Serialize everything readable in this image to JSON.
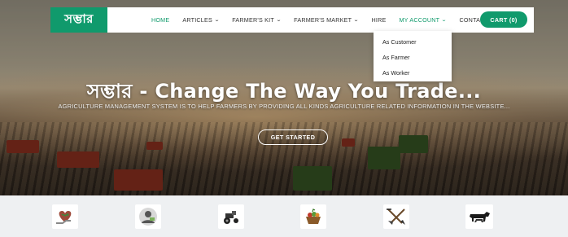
{
  "nav": {
    "logo_text": "সম্ভার",
    "items": [
      {
        "label": "HOME",
        "active": true,
        "has_caret": false
      },
      {
        "label": "ARTICLES",
        "active": false,
        "has_caret": true
      },
      {
        "label": "FARMER'S KIT",
        "active": false,
        "has_caret": true
      },
      {
        "label": "FARMER'S MARKET",
        "active": false,
        "has_caret": true
      },
      {
        "label": "HIRE",
        "active": false,
        "has_caret": false
      },
      {
        "label": "MY ACCOUNT",
        "active": false,
        "has_caret": true
      },
      {
        "label": "CONTACT",
        "active": false,
        "has_caret": false
      }
    ],
    "cart_label": "CART (0)"
  },
  "account_dropdown": {
    "items": [
      "As Customer",
      "As Farmer",
      "As Worker"
    ]
  },
  "hero": {
    "title": "সম্ভার - Change The Way You Trade...",
    "subtitle": "AGRICULTURE MANAGEMENT SYSTEM IS TO HELP FARMERS BY PROVIDING ALL KINDS AGRICULTURE RELATED INFORMATION IN THE WEBSITE...",
    "cta_label": "GET STARTED"
  },
  "categories": [
    {
      "icon": "heart-hand-icon"
    },
    {
      "icon": "farmer-avatar-icon"
    },
    {
      "icon": "tractor-icon"
    },
    {
      "icon": "vegetable-basket-icon"
    },
    {
      "icon": "shovel-rake-icon"
    },
    {
      "icon": "livestock-icon"
    }
  ],
  "colors": {
    "brand": "#109a6c",
    "nav_text": "#333333",
    "strip_bg": "#eef0f2"
  }
}
